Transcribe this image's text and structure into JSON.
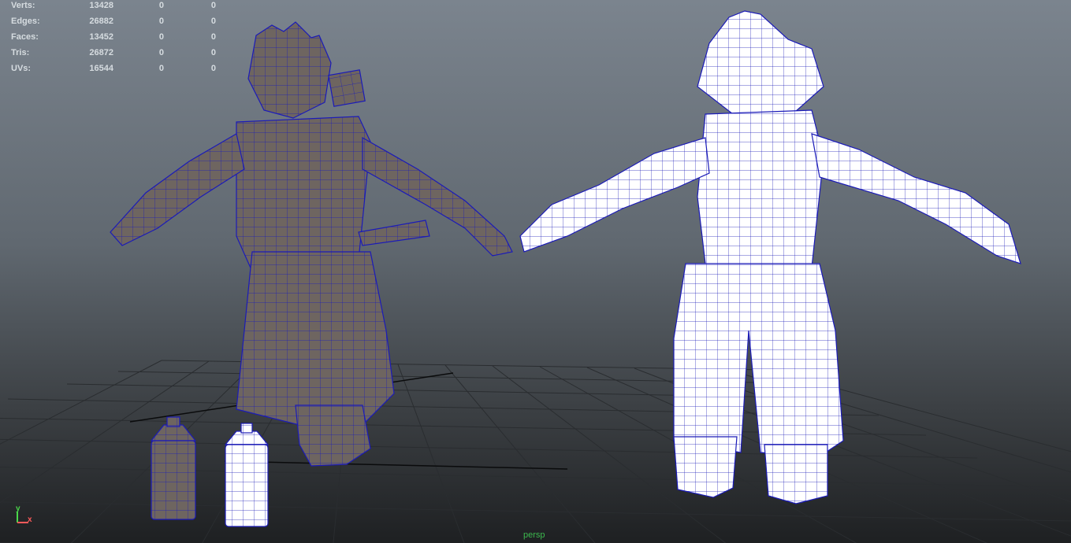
{
  "hud": {
    "rows": [
      {
        "label": "Verts:",
        "value": "13428",
        "sel": "0",
        "comp": "0"
      },
      {
        "label": "Edges:",
        "value": "26882",
        "sel": "0",
        "comp": "0"
      },
      {
        "label": "Faces:",
        "value": "13452",
        "sel": "0",
        "comp": "0"
      },
      {
        "label": "Tris:",
        "value": "26872",
        "sel": "0",
        "comp": "0"
      },
      {
        "label": "UVs:",
        "value": "16544",
        "sel": "0",
        "comp": "0"
      }
    ]
  },
  "camera_label": "persp",
  "axis": {
    "x": "x",
    "y": "y"
  },
  "colors": {
    "wireframe": "#1b1bb8",
    "shaded_mesh": "#6e6560",
    "white_mesh": "#ffffff",
    "grid": "#2a2d30",
    "hud_text": "#d6dce0",
    "camera_label": "#3cb84e",
    "axis_x": "#ff5a5a",
    "axis_y": "#4ad64a"
  }
}
